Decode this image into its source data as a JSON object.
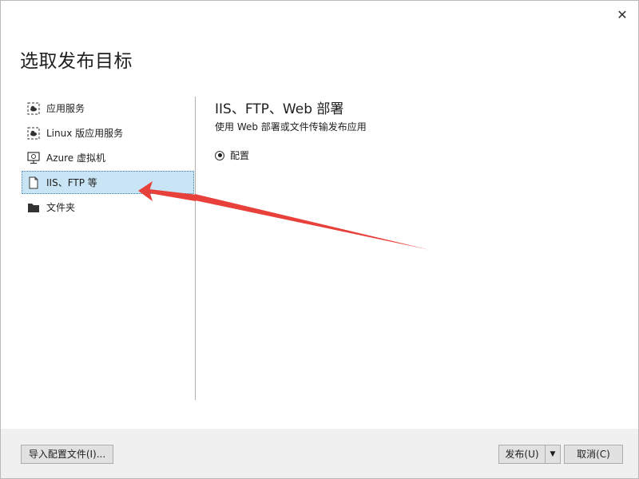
{
  "dialog": {
    "title": "选取发布目标",
    "close_symbol": "✕"
  },
  "sidebar": {
    "items": [
      {
        "label": "应用服务",
        "icon": "app-service-icon"
      },
      {
        "label": "Linux 版应用服务",
        "icon": "app-service-linux-icon"
      },
      {
        "label": "Azure 虚拟机",
        "icon": "vm-icon"
      },
      {
        "label": "IIS、FTP 等",
        "icon": "file-icon",
        "selected": true
      },
      {
        "label": "文件夹",
        "icon": "folder-icon"
      }
    ]
  },
  "panel": {
    "title": "IIS、FTP、Web 部署",
    "subtitle": "使用 Web 部署或文件传输发布应用",
    "option_label": "配置"
  },
  "footer": {
    "import_label": "导入配置文件(I)...",
    "publish_label": "发布(U)",
    "publish_dropdown_symbol": "▼",
    "cancel_label": "取消(C)"
  },
  "colors": {
    "selected_bg": "#c9e5f5",
    "selected_border": "#3c7fb1",
    "annotation_arrow": "#e8403a",
    "footer_bg": "#f0f0f0"
  }
}
